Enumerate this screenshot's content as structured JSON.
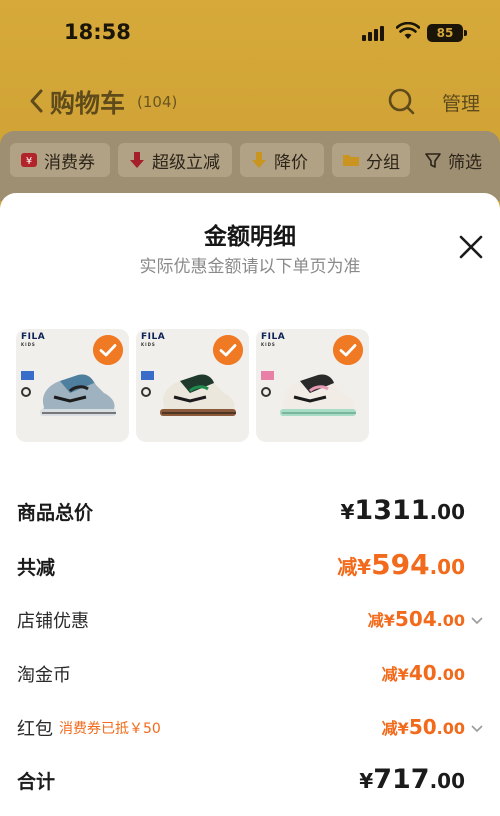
{
  "status_bar": {
    "time": "18:58",
    "battery": "85"
  },
  "nav": {
    "title": "购物车",
    "count": "(104)",
    "manage": "管理"
  },
  "filters": [
    {
      "label": "消费券"
    },
    {
      "label": "超级立减"
    },
    {
      "label": "降价"
    },
    {
      "label": "分组"
    },
    {
      "label": "筛选"
    }
  ],
  "sheet": {
    "title": "金额明细",
    "subtitle": "实际优惠金额请以下单页为准",
    "products": [
      {
        "brand": "FILA",
        "brand_sub": "KIDS",
        "selected": true
      },
      {
        "brand": "FILA",
        "brand_sub": "KIDS",
        "selected": true
      },
      {
        "brand": "FILA",
        "brand_sub": "KIDS",
        "selected": true
      }
    ],
    "rows": {
      "total_price": {
        "label": "商品总价",
        "currency": "¥",
        "integer": "1311",
        "decimal": ".00"
      },
      "total_discount": {
        "label": "共减",
        "prefix": "减¥",
        "integer": "594",
        "decimal": ".00"
      },
      "store_discount": {
        "label": "店铺优惠",
        "prefix": "减¥",
        "integer": "504",
        "decimal": ".00"
      },
      "taojinbi": {
        "label": "淘金币",
        "prefix": "减¥",
        "integer": "40",
        "decimal": ".00"
      },
      "red_packet": {
        "label": "红包",
        "note": "消费券已抵￥50",
        "prefix": "减¥",
        "integer": "50",
        "decimal": ".00"
      },
      "grand_total": {
        "label": "合计",
        "currency": "¥",
        "integer": "717",
        "decimal": ".00"
      }
    }
  },
  "colors": {
    "accent": "#f26a1b",
    "check": "#f07a24",
    "backdrop": "#c99a30"
  }
}
